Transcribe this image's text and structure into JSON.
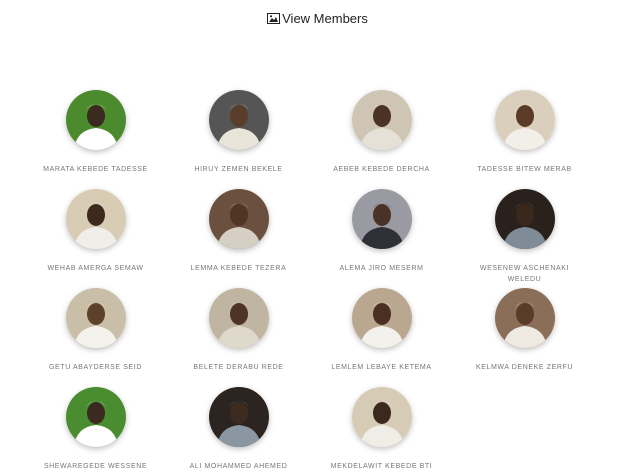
{
  "page": {
    "title": "View Members",
    "title_icon": "image-icon"
  },
  "members": [
    {
      "name": "MARATA KEBEDE TADESSE",
      "bg": "#4c8a2e",
      "wrap": "#ffffff",
      "skin": "#3b2a20"
    },
    {
      "name": "HIRUY ZEMEN BEKELE",
      "bg": "#555555",
      "wrap": "#e9e4da",
      "skin": "#5a3d2b"
    },
    {
      "name": "AEBEB KEBEDE DERCHA",
      "bg": "#cfc5b5",
      "wrap": "#e6e1d6",
      "skin": "#4a3224"
    },
    {
      "name": "TADESSE BITEW MERAB",
      "bg": "#d9cfbc",
      "wrap": "#f2efe8",
      "skin": "#5b3b28"
    },
    {
      "name": "WEHAB AMERGA SEMAW",
      "bg": "#d8ccb4",
      "wrap": "#f0eee8",
      "skin": "#3d2a1e"
    },
    {
      "name": "LEMMA KEBEDE TEZERA",
      "bg": "#6b5040",
      "wrap": "#d6d0c4",
      "skin": "#4f3526"
    },
    {
      "name": "ALEMA JIRO MESERM",
      "bg": "#9a9aa2",
      "wrap": "#2f2f38",
      "skin": "#4a3226"
    },
    {
      "name": "WESENEW ASCHENAKI WELEDU",
      "bg": "#2a211c",
      "wrap": "#7f8c98",
      "skin": "#3a281d"
    },
    {
      "name": "GETU ABAYDERSE SEID",
      "bg": "#c9bfa8",
      "wrap": "#f4f2ec",
      "skin": "#5e412d"
    },
    {
      "name": "BELETE DERABU REDE",
      "bg": "#bfb5a1",
      "wrap": "#dfd9cc",
      "skin": "#4e3425"
    },
    {
      "name": "LEMLEM LEBAYE KETEMA",
      "bg": "#b9a88f",
      "wrap": "#f3f1ec",
      "skin": "#4a3022"
    },
    {
      "name": "KELMWA DENEKE ZERFU",
      "bg": "#8a6e58",
      "wrap": "#eeeae2",
      "skin": "#5a3b2a"
    },
    {
      "name": "SHEWAREGEDE WESSENE",
      "bg": "#4a8c30",
      "wrap": "#ffffff",
      "skin": "#3b2a20"
    },
    {
      "name": "ALI MOHAMMED AHEMED",
      "bg": "#2c2420",
      "wrap": "#8a96a2",
      "skin": "#3e2b1f"
    },
    {
      "name": "MEKDELAWIT KEBEDE BTI",
      "bg": "#d6ccb6",
      "wrap": "#f0ede6",
      "skin": "#3c291e"
    }
  ]
}
